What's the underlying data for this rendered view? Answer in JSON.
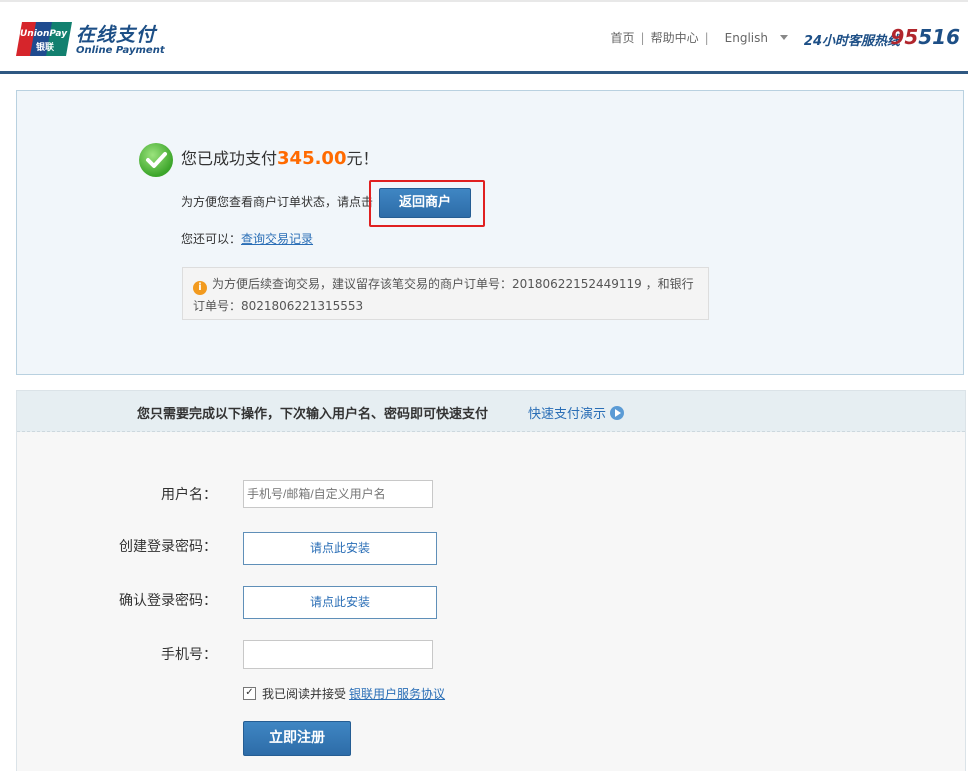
{
  "header": {
    "logo_text": "UnionPay 银联",
    "brand_title": "在线支付",
    "brand_subtitle": "Online Payment",
    "nav": {
      "home": "首页",
      "help": "帮助中心",
      "language": "English"
    },
    "hotline_label": "24小时客服热线",
    "hotline_prefix": "95",
    "hotline_suffix": "516"
  },
  "result": {
    "success_prefix": "您已成功支付",
    "amount": "345.00",
    "success_suffix": "元！",
    "return_hint": "为方便您查看商户订单状态，请点击",
    "return_button": "返回商户",
    "also_label": "您还可以：",
    "query_link": "查询交易记录",
    "notice": "为方便后续查询交易，建议留存该笔交易的商户订单号：20180622152449119 ，和银行订单号：8021806221315553"
  },
  "quick_pay": {
    "heading": "您只需要完成以下操作，下次输入用户名、密码即可快速支付",
    "demo_link": "快速支付演示"
  },
  "form": {
    "username_label": "用户名：",
    "username_placeholder": "手机号/邮箱/自定义用户名",
    "create_password_label": "创建登录密码：",
    "create_password_action": "请点此安装",
    "confirm_password_label": "确认登录密码：",
    "confirm_password_action": "请点此安装",
    "phone_label": "手机号：",
    "phone_value": "",
    "agree_text": "我已阅读并接受",
    "agree_checked": true,
    "agreement_link": "银联用户服务协议",
    "register_button": "立即注册"
  }
}
